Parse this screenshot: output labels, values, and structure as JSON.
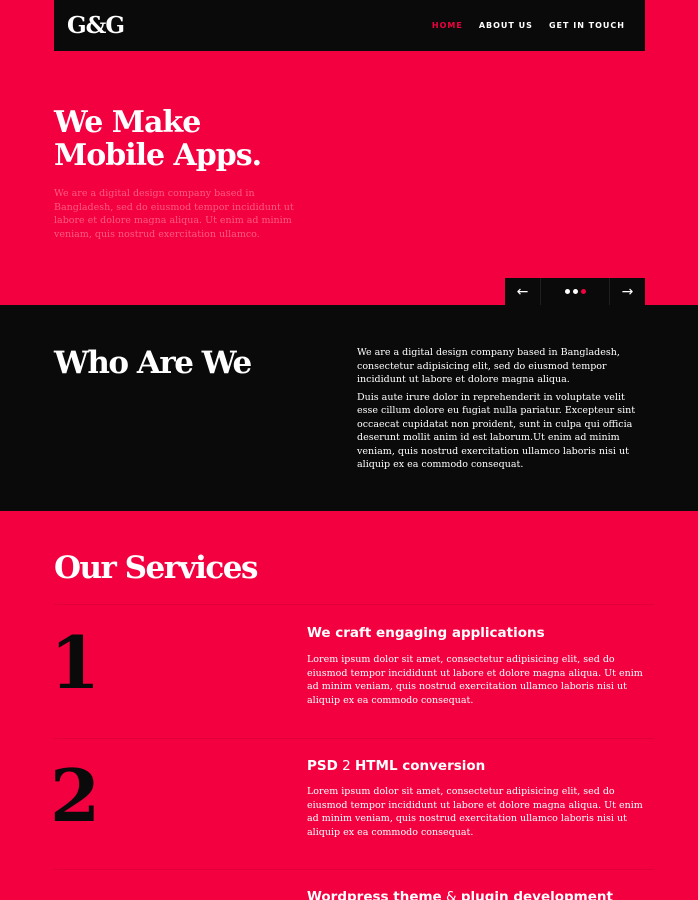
{
  "nav": {
    "logo": "G&G",
    "items": [
      {
        "label": "HOME",
        "active": true
      },
      {
        "label": "ABOUT US",
        "active": false
      },
      {
        "label": "GET IN TOUCH",
        "active": false
      }
    ]
  },
  "hero": {
    "title_line1": "We Make",
    "title_line2": "Mobile Apps.",
    "text": "We are a digital design company based in Bangladesh, sed do eiusmod tempor incididunt ut labore et dolore magna aliqua. Ut enim ad minim veniam, quis nostrud exercitation ullamco."
  },
  "slider": {
    "prev_icon": "arrow-left-icon",
    "next_icon": "arrow-right-icon",
    "prev_glyph": "←",
    "next_glyph": "→",
    "dot_count": 3,
    "active_dot": 3
  },
  "who": {
    "title": "Who Are We",
    "para1": "We are a digital design company based in Bangladesh, consectetur adipisicing elit, sed do eiusmod tempor incididunt ut labore et dolore magna aliqua.",
    "para2": "Duis aute irure dolor in reprehenderit in voluptate velit esse cillum dolore eu fugiat nulla pariatur. Excepteur sint occaecat cupidatat non proident, sunt in culpa qui officia deserunt mollit anim id est laborum.Ut enim ad minim veniam, quis nostrud exercitation ullamco laboris nisi ut aliquip ex ea commodo consequat."
  },
  "services": {
    "title": "Our Services",
    "items": [
      {
        "number": "1",
        "title": "We craft engaging applications",
        "text": "Lorem ipsum dolor sit amet, consectetur adipisicing elit, sed do eiusmod tempor incididunt ut labore et dolore magna aliqua. Ut enim ad minim veniam, quis nostrud exercitation ullamco laboris nisi ut aliquip ex ea commodo consequat."
      },
      {
        "number": "2",
        "title_a": "PSD",
        "title_b": " 2 ",
        "title_c": "HTML conversion",
        "text": "Lorem ipsum dolor sit amet, consectetur adipisicing elit, sed do eiusmod tempor incididunt ut labore et dolore magna aliqua. Ut enim ad minim veniam, quis nostrud exercitation ullamco laboris nisi ut aliquip ex ea commodo consequat."
      },
      {
        "title_a": "Wordpress theme",
        "title_b": " & ",
        "title_c": "plugin development"
      }
    ]
  },
  "colors": {
    "brand_red": "#f20040",
    "dark": "#0a0a0a",
    "muted_text": "#ff5b80"
  }
}
